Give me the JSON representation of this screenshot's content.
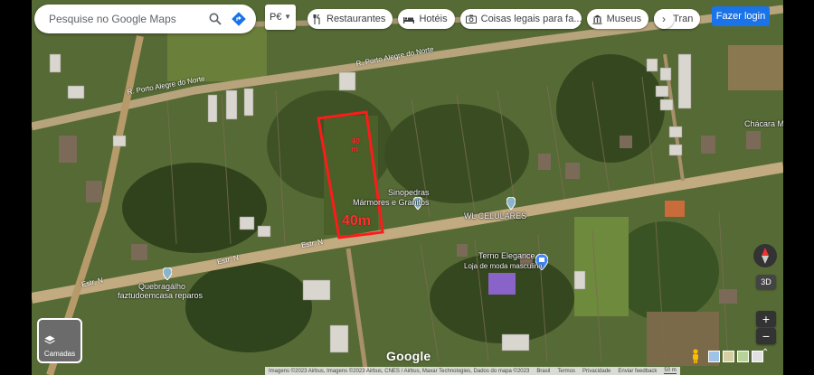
{
  "search": {
    "placeholder": "Pesquise no Google Maps"
  },
  "lang": {
    "value": "P€"
  },
  "chips": [
    {
      "label": "Restaurantes",
      "icon": "fork-knife-icon"
    },
    {
      "label": "Hotéis",
      "icon": "bed-icon"
    },
    {
      "label": "Coisas legais para fa...",
      "icon": "camera-icon"
    },
    {
      "label": "Museus",
      "icon": "museum-icon"
    },
    {
      "label": "Tran",
      "icon": "train-icon"
    }
  ],
  "signin": {
    "label": "Fazer login"
  },
  "layers": {
    "label": "Camadas"
  },
  "brand": {
    "logo": "Google"
  },
  "footer": {
    "imagery": "Imagens ©2023 Airbus, Imagens ©2023 Airbus, CNES / Airbus, Maxar Technologies, Dados do mapa ©2023",
    "links": [
      "Brasil",
      "Termos",
      "Privacidade",
      "Enviar feedback"
    ],
    "scale": "50 m"
  },
  "controls": {
    "three_d": "3D",
    "zoom_in": "+",
    "zoom_out": "−"
  },
  "places": {
    "road1": "R. Porto Alegre do Norte",
    "road2": "R. Porto Alegre do Norte",
    "estrN1": "Estr. N",
    "estrN2": "Estr. N",
    "estrN3": "Estr. N",
    "chacara": "Chácara Mió do m",
    "sinopedras": "Sinopedras",
    "marmores": "Mármores e Granitos",
    "wl": "WL CELULARES",
    "terno": "Terno Elegance",
    "loja": "Loja de moda masculina",
    "quebra": "Quebragálho",
    "faztudo": "faztudoemcasa reparos"
  },
  "annotation": {
    "top_mark": "40",
    "top_mark2": "m",
    "bottom_mark": "40m"
  },
  "colors": {
    "accent": "#1a73e8",
    "mark": "#ff1a1a"
  }
}
